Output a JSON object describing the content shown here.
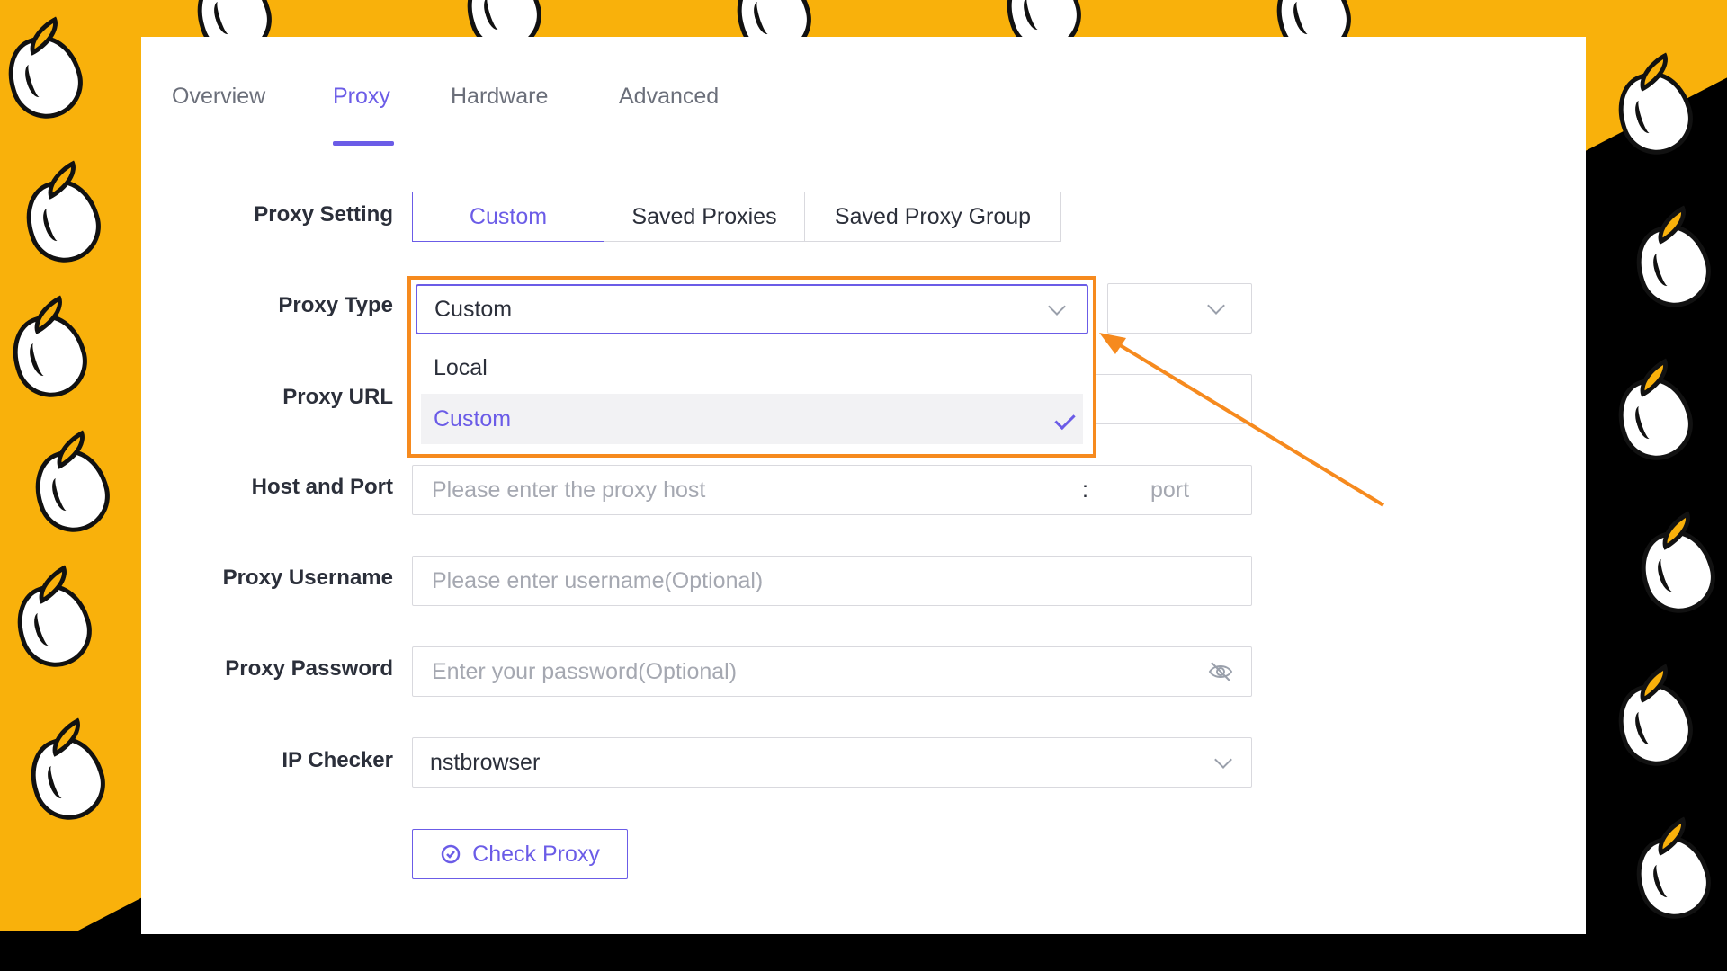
{
  "tabs": [
    {
      "label": "Overview",
      "active": false
    },
    {
      "label": "Proxy",
      "active": true
    },
    {
      "label": "Hardware",
      "active": false
    },
    {
      "label": "Advanced",
      "active": false
    }
  ],
  "proxy_setting": {
    "label": "Proxy Setting",
    "options": [
      "Custom",
      "Saved Proxies",
      "Saved Proxy Group"
    ],
    "selected": "Custom"
  },
  "proxy_type": {
    "label": "Proxy Type",
    "value": "Custom",
    "menu_items": [
      "Local",
      "Custom"
    ],
    "selected": "Custom"
  },
  "proxy_url": {
    "label": "Proxy URL"
  },
  "host_and_port": {
    "label": "Host and Port",
    "host_placeholder": "Please enter the proxy host",
    "separator": ":",
    "port_placeholder": "port"
  },
  "proxy_username": {
    "label": "Proxy Username",
    "placeholder": "Please enter username(Optional)"
  },
  "proxy_password": {
    "label": "Proxy Password",
    "placeholder": "Enter your password(Optional)"
  },
  "ip_checker": {
    "label": "IP Checker",
    "value": "nstbrowser"
  },
  "check_proxy_button": {
    "label": "Check Proxy"
  },
  "colors": {
    "accent": "#6b5ce7",
    "highlight_box": "#F68A1E",
    "background_yellow": "#F9B10B"
  }
}
